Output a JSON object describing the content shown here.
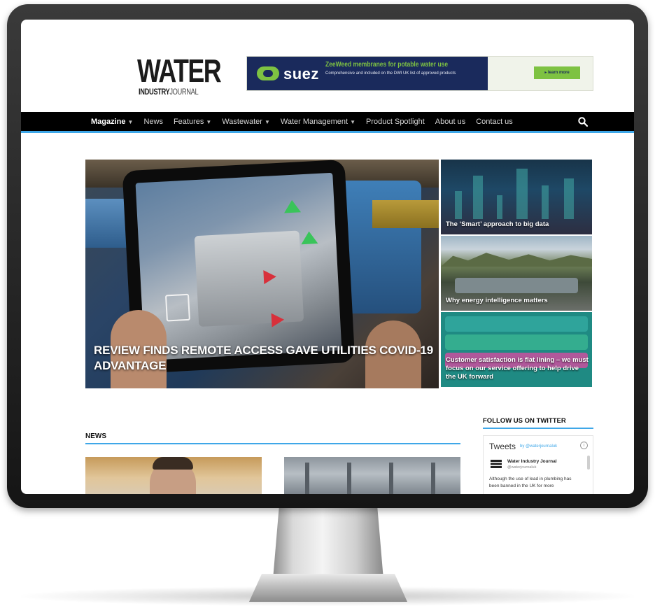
{
  "site": {
    "logo_main": "WATER",
    "logo_sub_bold": "INDUSTRY",
    "logo_sub_light": "JOURNAL"
  },
  "ad_banner": {
    "brand": "suez",
    "headline": "ZeeWeed membranes for potable water use",
    "copy": "Comprehensive and included on the DWI UK list of approved products",
    "cta": "▸ learn more"
  },
  "nav": {
    "items": [
      {
        "label": "Magazine",
        "dropdown": true,
        "active": true
      },
      {
        "label": "News",
        "dropdown": false,
        "active": false
      },
      {
        "label": "Features",
        "dropdown": true,
        "active": false
      },
      {
        "label": "Wastewater",
        "dropdown": true,
        "active": false
      },
      {
        "label": "Water Management",
        "dropdown": true,
        "active": false
      },
      {
        "label": "Product Spotlight",
        "dropdown": false,
        "active": false
      },
      {
        "label": "About us",
        "dropdown": false,
        "active": false
      },
      {
        "label": "Contact us",
        "dropdown": false,
        "active": false
      }
    ],
    "search_icon": "search-icon"
  },
  "hero": {
    "title": "REVIEW FINDS REMOTE ACCESS GAVE UTILITIES COVID-19 ADVANTAGE"
  },
  "side_stories": [
    {
      "title": "The ‘Smart’ approach to big data"
    },
    {
      "title": "Why energy intelligence matters"
    },
    {
      "title": "Customer satisfaction is flat lining – we must focus on our service offering to help drive the UK forward"
    }
  ],
  "news": {
    "heading": "NEWS"
  },
  "twitter": {
    "heading": "FOLLOW US ON TWITTER",
    "widget_title": "Tweets",
    "widget_by": "by @waterjournaluk",
    "tweet_author": "Water Industry Journal",
    "tweet_handle": "@waterjournaluk",
    "tweet_text": "Although the use of lead in plumbing has been banned in the UK for more"
  },
  "colors": {
    "accent": "#3ea7e8",
    "nav_bg": "#000000",
    "banner_navy": "#1a2a5c",
    "banner_green": "#7ec242"
  }
}
